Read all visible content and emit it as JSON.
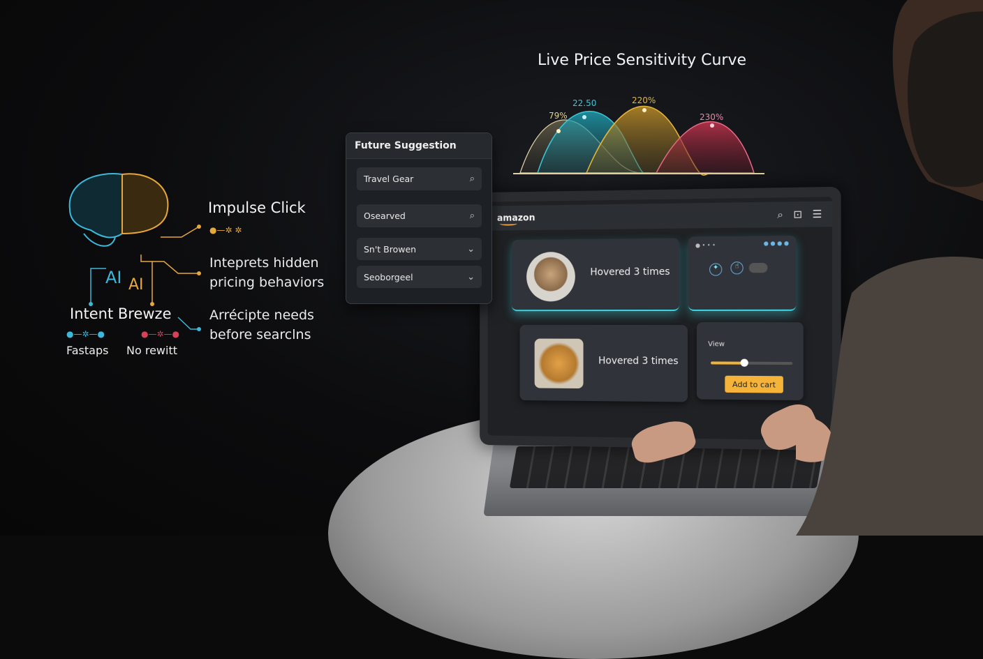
{
  "chart": {
    "title": "Live Price Sensitivity Curve",
    "labels": [
      "79%",
      "22.50",
      "220%",
      "230%"
    ],
    "colors": [
      "#e8d28a",
      "#3cc6d8",
      "#e5b63a",
      "#d94460"
    ]
  },
  "left_panel": {
    "ai_label_1": "AI",
    "ai_label_2": "AI",
    "impulse_click": "Impulse Click",
    "interprets_line1": "Inteprets hidden",
    "interprets_line2": "pricing behaviors",
    "anticipate_line1": "Arrécipte needs",
    "anticipate_line2": "before searclns",
    "intent": "Intent Brewze",
    "fast_taps": "Fastaps",
    "no_rewrite": "No rewitt"
  },
  "suggestion_panel": {
    "title": "Future Suggestion",
    "fields": [
      {
        "label": "Travel Gear",
        "icon": "search-icon"
      },
      {
        "label": "Osearved",
        "icon": "search-icon"
      },
      {
        "label": "Sn't Browen",
        "icon": "chevron-down-icon"
      },
      {
        "label": "Seoborgeel",
        "icon": "chevron-down-icon"
      }
    ]
  },
  "store": {
    "logo": "amazon",
    "cards": [
      {
        "text": "Hovered 3 times"
      },
      {
        "text": "Hovered 3 times"
      }
    ],
    "view_label": "View",
    "slider_value": 0.4,
    "add_to_cart": "Add to cart"
  }
}
